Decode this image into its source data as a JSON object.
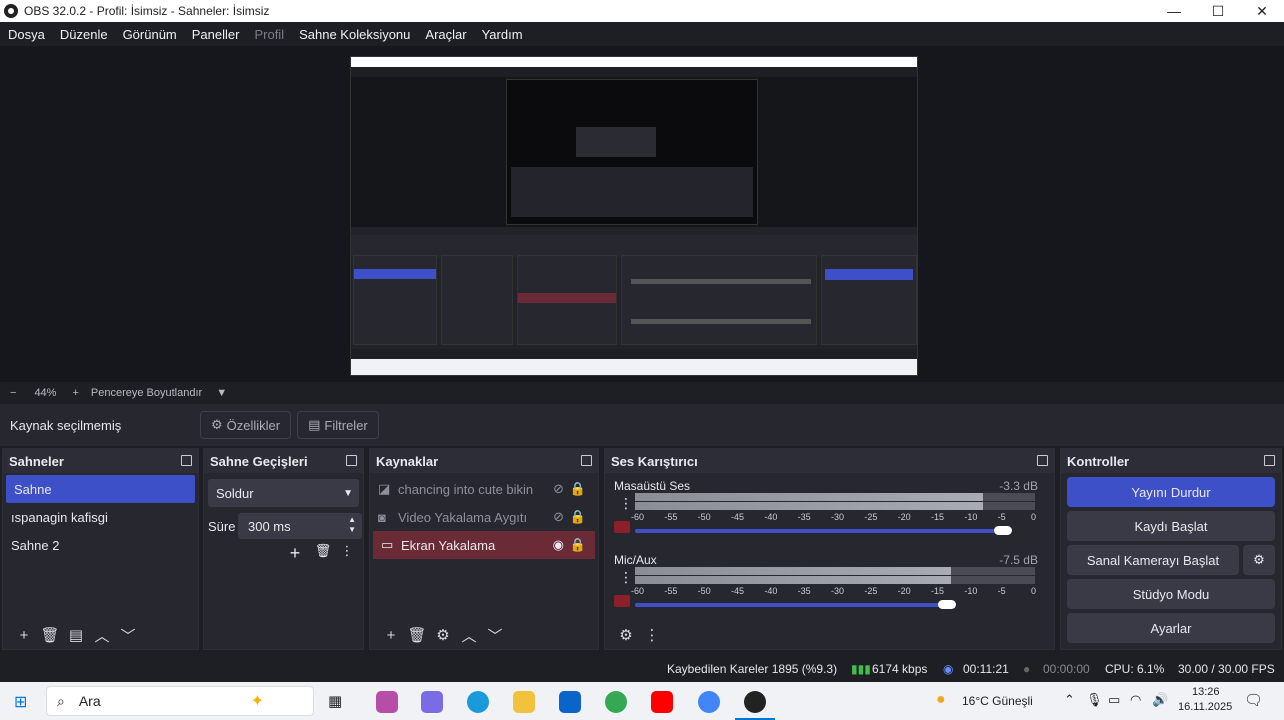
{
  "window": {
    "title": "OBS 32.0.2 - Profil: İsimsiz - Sahneler: İsimsiz",
    "min": "—",
    "max": "☐",
    "close": "✕"
  },
  "menu": [
    "Dosya",
    "Düzenle",
    "Görünüm",
    "Paneller",
    "Profil",
    "Sahne Koleksiyonu",
    "Araçlar",
    "Yardım"
  ],
  "zoom": {
    "minus": "−",
    "value": "44%",
    "plus": "+",
    "mode": "Pencereye Boyutlandır"
  },
  "source_toolbar": {
    "none_selected": "Kaynak seçilmemiş",
    "properties": "Özellikler",
    "filters": "Filtreler"
  },
  "scenes": {
    "title": "Sahneler",
    "items": [
      "Sahne",
      "ıspanagin kafisgi",
      "Sahne 2"
    ]
  },
  "transitions": {
    "title": "Sahne Geçişleri",
    "selected": "Soldur",
    "duration_label": "Süre",
    "duration_value": "300 ms"
  },
  "sources": {
    "title": "Kaynaklar",
    "items": [
      {
        "name": "chancing into cute bikin",
        "icon": "window-capture-icon"
      },
      {
        "name": "Video Yakalama Aygıtı",
        "icon": "camera-icon"
      },
      {
        "name": "Ekran Yakalama",
        "icon": "monitor-icon"
      }
    ]
  },
  "mixer": {
    "title": "Ses Karıştırıcı",
    "channels": [
      {
        "name": "Masaüstü Ses",
        "db": "-3.3 dB",
        "level": 0.87,
        "volume": 0.92
      },
      {
        "name": "Mic/Aux",
        "db": "-7.5 dB",
        "level": 0.79,
        "volume": 0.78
      }
    ],
    "scale": [
      "-60",
      "-55",
      "-50",
      "-45",
      "-40",
      "-35",
      "-30",
      "-25",
      "-20",
      "-15",
      "-10",
      "-5",
      "0"
    ]
  },
  "controls": {
    "title": "Kontroller",
    "stream": "Yayını Durdur",
    "record": "Kaydı Başlat",
    "vcam": "Sanal Kamerayı Başlat",
    "studio": "Stüdyo Modu",
    "settings": "Ayarlar"
  },
  "status": {
    "dropped": "Kaybedilen Kareler 1895 (%9.3)",
    "bitrate": "6174 kbps",
    "stream_time": "00:11:21",
    "rec_time": "00:00:00",
    "cpu": "CPU: 6.1%",
    "fps": "30.00 / 30.00 FPS"
  },
  "taskbar": {
    "search": "Ara",
    "weather": "16°C  Güneşli",
    "time": "13:26",
    "date": "16.11.2025"
  },
  "colors": {
    "accent": "#3d50c8",
    "panel": "#26272f",
    "bg": "#1e1f25",
    "selected_source": "#6b2b36"
  }
}
